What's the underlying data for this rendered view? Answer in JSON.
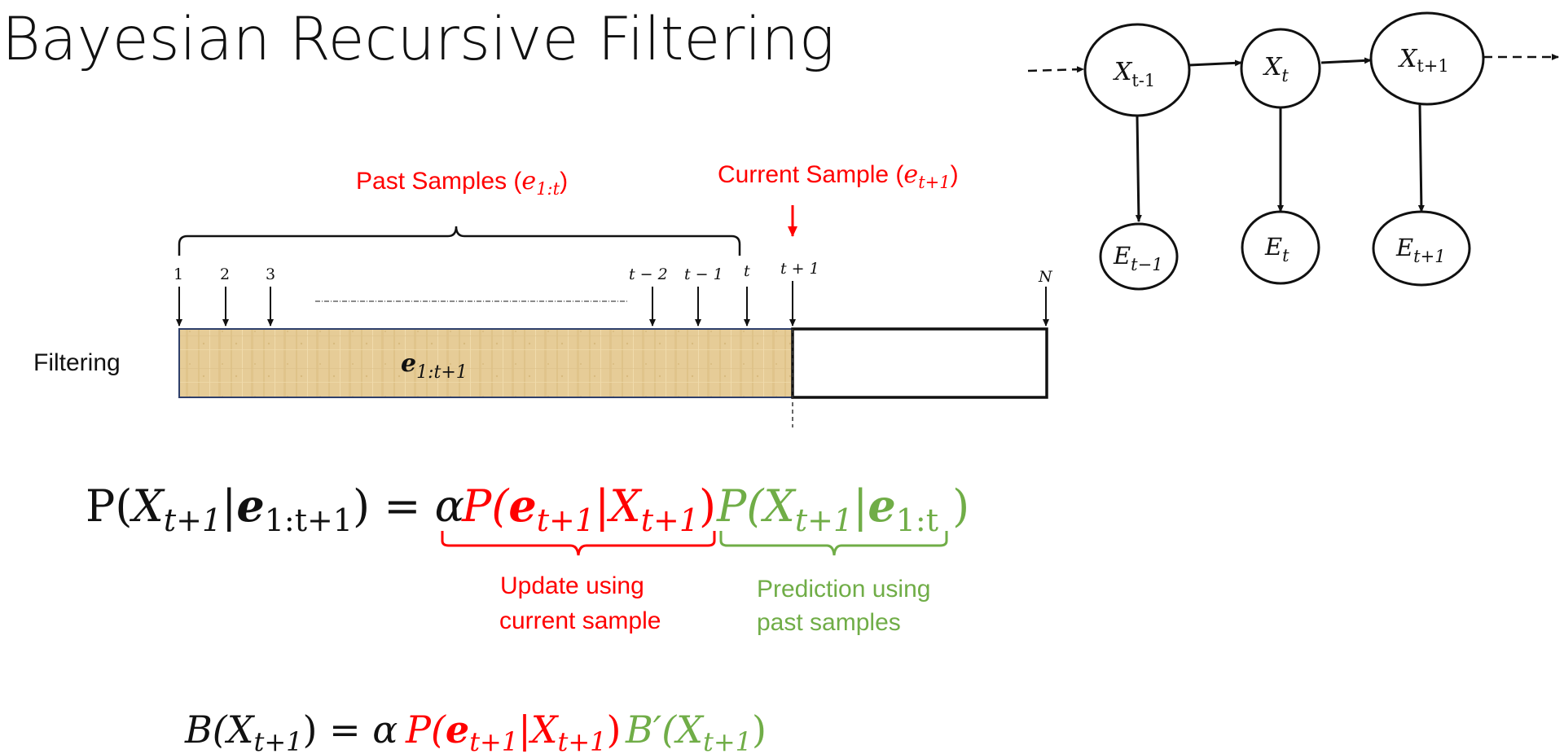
{
  "title": "Bayesian Recursive Filtering",
  "colors": {
    "update": "#ff0000",
    "prediction": "#70ad47",
    "text": "#111111",
    "parchment": "#e8cf9a"
  },
  "timeline": {
    "row_label": "Filtering",
    "bar_label_var": "e",
    "bar_label_sub": "1:t+1",
    "past_label": "Past Samples (",
    "past_var": "e",
    "past_sub": "1:t",
    "past_close": ")",
    "current_label": "Current Sample (",
    "current_var": "e",
    "current_sub": "t+1",
    "current_close": ")",
    "ticks": [
      "1",
      "2",
      "3",
      "t − 2",
      "t − 1",
      "t",
      "t + 1",
      "N"
    ]
  },
  "network": {
    "hidden": [
      {
        "var": "X",
        "sub": "t-1"
      },
      {
        "var": "X",
        "sub": "t"
      },
      {
        "var": "X",
        "sub": "t+1"
      }
    ],
    "evidence": [
      {
        "var": "E",
        "sub": "t−1"
      },
      {
        "var": "E",
        "sub": "t"
      },
      {
        "var": "E",
        "sub": "t+1"
      }
    ]
  },
  "equation1": {
    "lhs_p": "P(",
    "lhs_x": "X",
    "lhs_xsub": "t+1",
    "lhs_bar": "|",
    "lhs_e": "e",
    "lhs_esub": "1:t+1",
    "lhs_close": ")",
    "eq": " = α ",
    "upd_p": "P(",
    "upd_e": "e",
    "upd_esub": "t+1",
    "upd_bar": "|",
    "upd_x": "X",
    "upd_xsub": "t+1",
    "upd_close": ")",
    "pred_p": "P(",
    "pred_x": "X",
    "pred_xsub": "t+1",
    "pred_bar": "|",
    "pred_e": "e",
    "pred_esub": "1:t",
    "pred_close": " )",
    "update_caption_1": "Update using",
    "update_caption_2": "current sample",
    "prediction_caption_1": "Prediction using",
    "prediction_caption_2": "past samples"
  },
  "equation2": {
    "lhs_b": "B(",
    "lhs_x": "X",
    "lhs_xsub": "t+1",
    "lhs_close": ")",
    "eq": " = α ",
    "upd_p": "P(",
    "upd_e": "e",
    "upd_esub": "t+1",
    "upd_bar": "|",
    "upd_x": "X",
    "upd_xsub": "t+1",
    "upd_close": ")",
    "pred_b": "B′(",
    "pred_x": "X",
    "pred_xsub": "t+1",
    "pred_close": ")"
  }
}
